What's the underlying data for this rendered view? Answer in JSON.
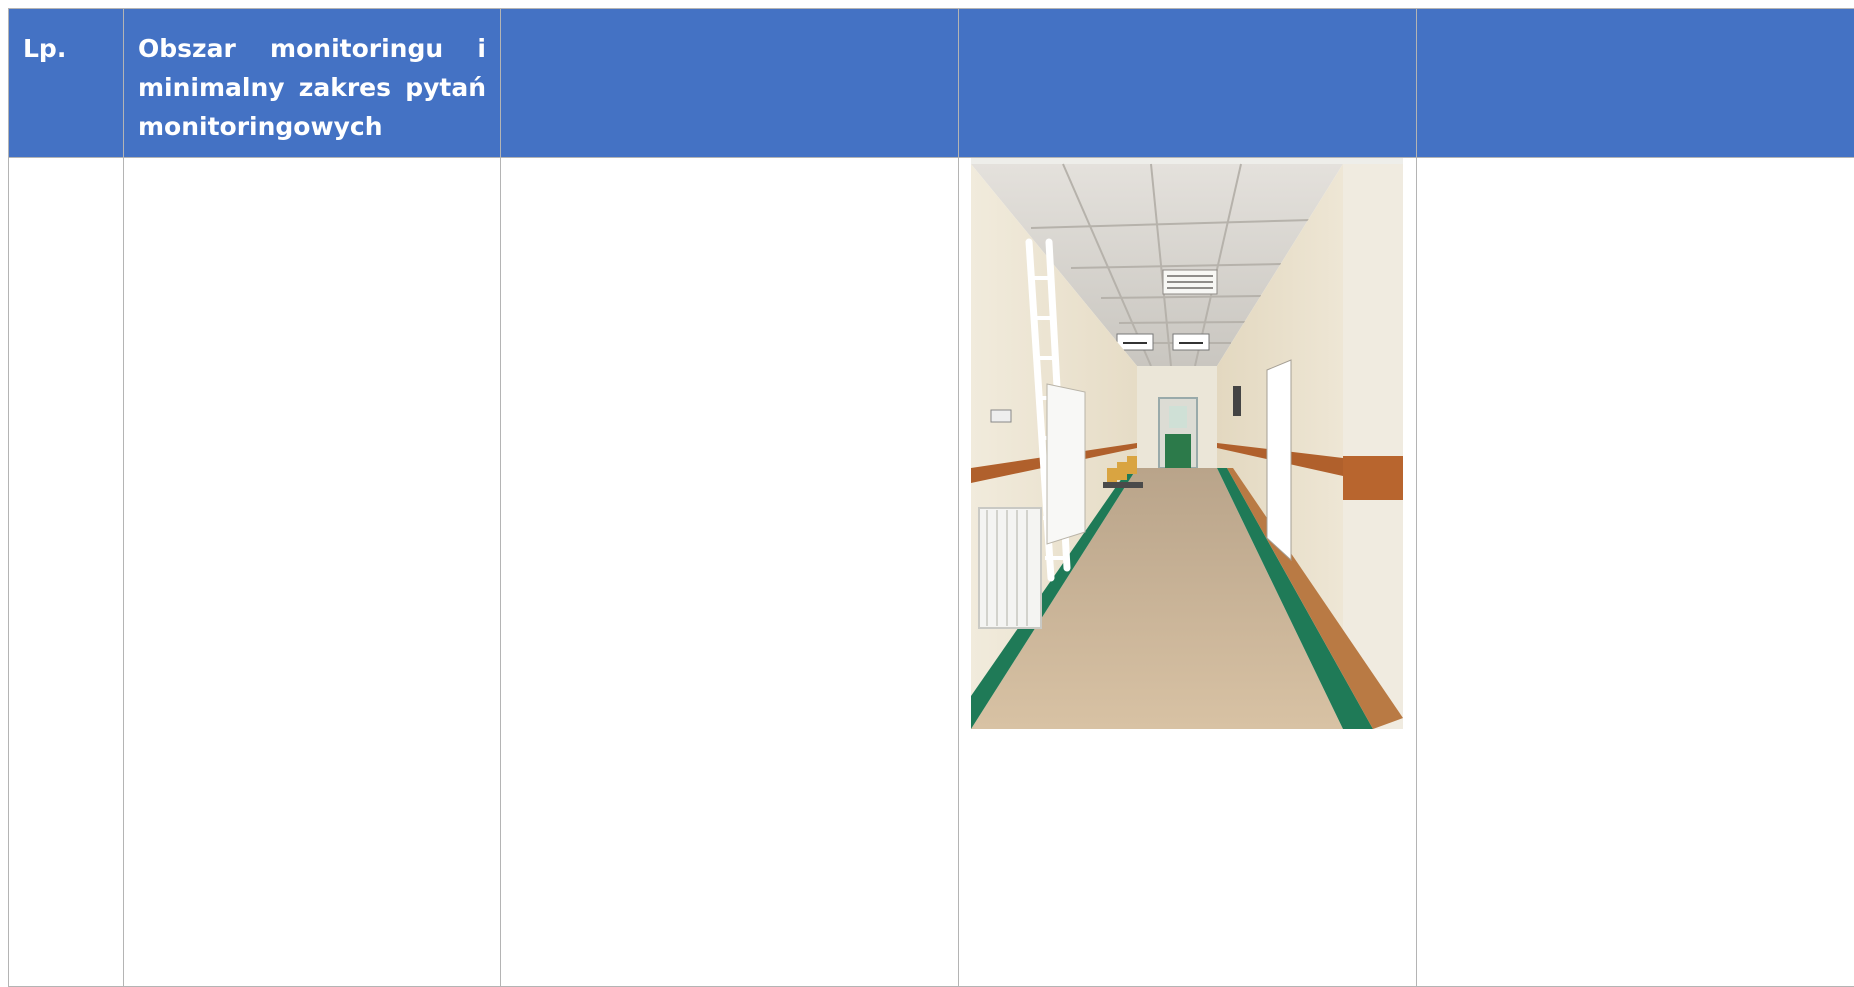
{
  "table": {
    "headers": [
      {
        "text": "Lp."
      },
      {
        "text": "Obszar monitoringu i minimalny zakres pytań monitoringowych"
      },
      {
        "text": ""
      },
      {
        "text": ""
      },
      {
        "text": ""
      }
    ],
    "row": {
      "cells": [
        "",
        "",
        "",
        "",
        ""
      ],
      "photo_cell_index": 3,
      "photo_subject": "hospital-corridor-photo"
    }
  },
  "colors": {
    "header_bg": "#4472c4",
    "header_text": "#ffffff",
    "border": "#b4b4b4"
  }
}
